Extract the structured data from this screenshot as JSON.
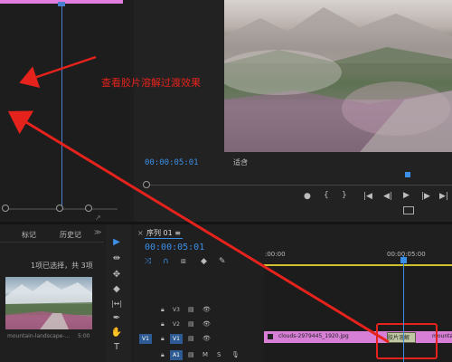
{
  "source_monitor": {
    "zoom_icon": "expand-icon"
  },
  "program_monitor": {
    "timecode": "00:00:05:01",
    "fit_label": "适合",
    "controls": [
      "marker-icon",
      "in-point-icon",
      "out-point-icon",
      "go-to-in-icon",
      "step-back-icon",
      "play-icon",
      "step-forward-icon",
      "go-to-out-icon"
    ],
    "control_glyphs": [
      "●",
      "{",
      "}",
      "|◀",
      "◀|",
      "▶",
      "|▶",
      "▶|"
    ]
  },
  "project_panel": {
    "tab1": "标记",
    "tab2": "历史记",
    "menu": "≫",
    "selection_info": "1项已选择，共 3项",
    "clip_name": "mountain-landscape-...",
    "clip_duration": "5:00"
  },
  "tools": [
    "▶",
    "⇹",
    "✥",
    "◆",
    "|↔|",
    "✒",
    "✋",
    "T"
  ],
  "timeline": {
    "close_glyph": "×",
    "title": "序列 01",
    "menu": "≡",
    "timecode": "00:00:05:01",
    "ruler_labels": [
      ":00:00",
      "00:00:05:00"
    ],
    "tracks": [
      {
        "name": "V3",
        "src": "",
        "toggle_icon": "film",
        "eye": "👁"
      },
      {
        "name": "V2",
        "src": "",
        "toggle_icon": "film",
        "eye": "👁"
      },
      {
        "name": "V1",
        "src": "V1",
        "toggle_icon": "film",
        "eye": "👁"
      },
      {
        "name": "A1",
        "src": "",
        "toggle_icon": "film",
        "eye": "M"
      }
    ],
    "clip_name": "clouds-2979445_1920.jpg",
    "clip_name2": "mounta",
    "transition_label": "胶片溶解"
  },
  "annotation": {
    "text": "查看胶片溶解过渡效果",
    "color": "#e6221c"
  }
}
